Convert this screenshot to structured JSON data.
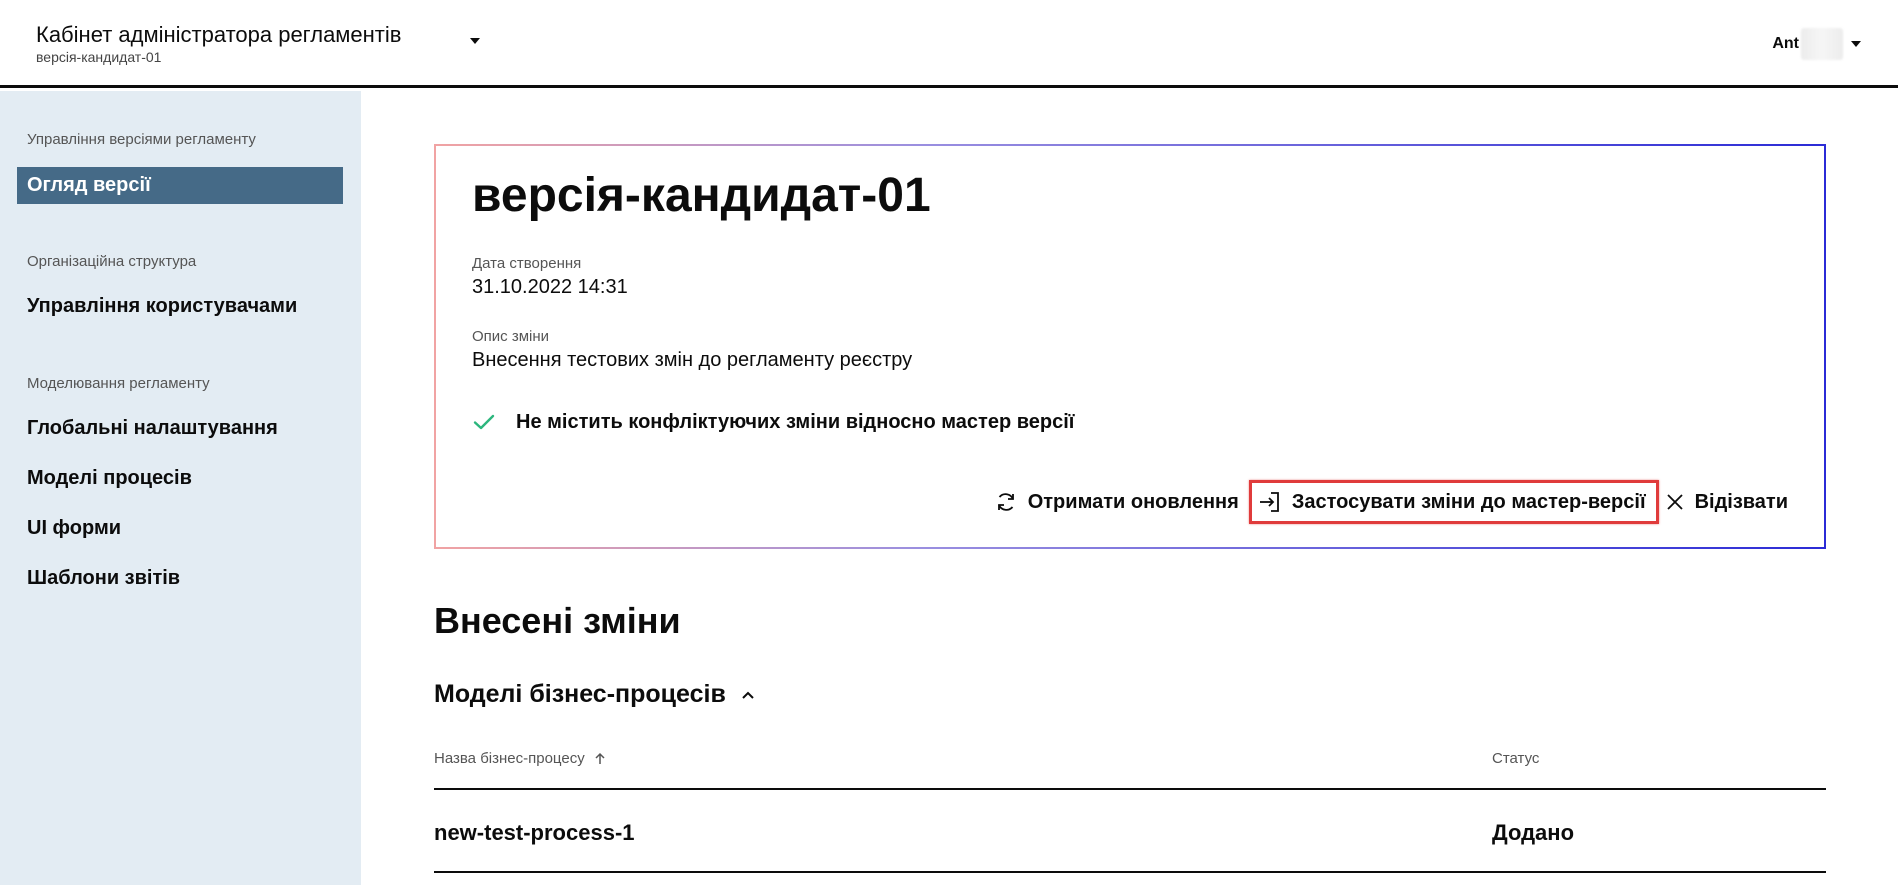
{
  "header": {
    "title": "Кабінет адміністратора регламентів",
    "subtitle": "версія-кандидат-01",
    "user_name": "Ant"
  },
  "sidebar": {
    "groups": [
      {
        "label": "Управління версіями регламенту",
        "items": [
          {
            "label": "Огляд версії",
            "active": true
          }
        ]
      },
      {
        "label": "Організаційна структура",
        "items": [
          {
            "label": "Управління користувачами"
          }
        ]
      },
      {
        "label": "Моделювання регламенту",
        "items": [
          {
            "label": "Глобальні налаштування"
          },
          {
            "label": "Моделі процесів"
          },
          {
            "label": "UI форми"
          },
          {
            "label": "Шаблони звітів"
          }
        ]
      }
    ]
  },
  "version": {
    "title": "версія-кандидат-01",
    "created_label": "Дата створення",
    "created_value": "31.10.2022 14:31",
    "description_label": "Опис зміни",
    "description_value": "Внесення тестових змін до регламенту реєстру",
    "conflict_status": "Не містить конфліктуючих зміни відносно мастер версії",
    "actions": {
      "refresh": "Отримати оновлення",
      "apply": "Застосувати зміни до мастер-версії",
      "revoke": "Відізвати"
    }
  },
  "changes": {
    "title": "Внесені зміни",
    "section_title": "Моделі бізнес-процесів",
    "columns": {
      "name": "Назва бізнес-процесу",
      "status": "Статус"
    },
    "rows": [
      {
        "name": "new-test-process-1",
        "status": "Додано"
      }
    ]
  },
  "colors": {
    "sidebar_bg": "#e3ecf3",
    "active_item_bg": "#456a87",
    "check_green": "#2cb67d",
    "highlight_red": "#e03b3b"
  }
}
